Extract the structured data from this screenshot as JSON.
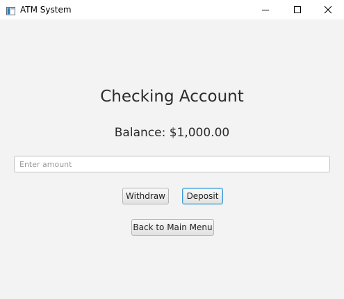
{
  "window": {
    "title": "ATM System",
    "icon": "app-window-icon",
    "controls": {
      "minimize_icon": "minimize-icon",
      "maximize_icon": "maximize-icon",
      "close_icon": "close-icon"
    }
  },
  "account": {
    "heading": "Checking Account",
    "balance_text": "Balance: $1,000.00"
  },
  "amount_input": {
    "placeholder": "Enter amount",
    "value": ""
  },
  "actions": {
    "withdraw_label": "Withdraw",
    "deposit_label": "Deposit",
    "back_label": "Back to Main Menu"
  },
  "colors": {
    "background": "#f3f3f3",
    "focus_accent": "#3c9ad6"
  }
}
